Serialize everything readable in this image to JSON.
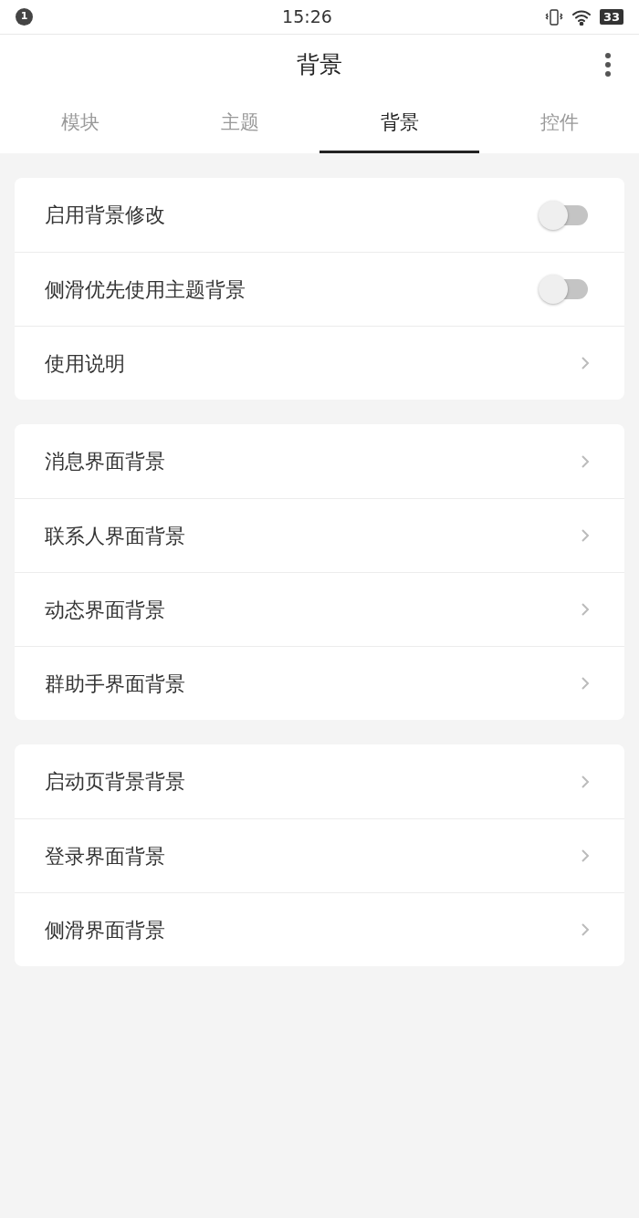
{
  "status_bar": {
    "notification_count": "1",
    "time": "15:26",
    "battery": "33"
  },
  "header": {
    "title": "背景"
  },
  "tabs": [
    {
      "label": "模块",
      "selected": false
    },
    {
      "label": "主题",
      "selected": false
    },
    {
      "label": "背景",
      "selected": true
    },
    {
      "label": "控件",
      "selected": false
    }
  ],
  "groups": [
    {
      "items": [
        {
          "kind": "toggle",
          "label": "启用背景修改",
          "on": false
        },
        {
          "kind": "toggle",
          "label": "侧滑优先使用主题背景",
          "on": false
        },
        {
          "kind": "link",
          "label": "使用说明"
        }
      ]
    },
    {
      "items": [
        {
          "kind": "link",
          "label": "消息界面背景"
        },
        {
          "kind": "link",
          "label": "联系人界面背景"
        },
        {
          "kind": "link",
          "label": "动态界面背景"
        },
        {
          "kind": "link",
          "label": "群助手界面背景"
        }
      ]
    },
    {
      "items": [
        {
          "kind": "link",
          "label": "启动页背景背景"
        },
        {
          "kind": "link",
          "label": "登录界面背景"
        },
        {
          "kind": "link",
          "label": "侧滑界面背景"
        }
      ]
    }
  ]
}
